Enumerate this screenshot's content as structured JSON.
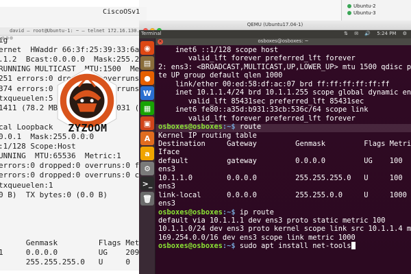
{
  "vm_list": {
    "items": [
      "Ubuntu-2",
      "Ubuntu-3"
    ]
  },
  "left_terminal": {
    "top_title": "CiscoOSv1",
    "titlebar": "david — root@Ubuntu-1: ~ — telnet 172.16.130.135 5005",
    "lines": [
      "ig",
      "ernet  HWaddr 66:3f:25:39:33:6a",
      ".1.2  Bcast:0.0.0.0  Mask:255.255.255.0",
      "RUNNING MULTICAST  MTU:1500  Metric:1",
      "251 errors:0 dropped:0 overruns:0",
      "374 errors:0 dropped:0 overruns:0",
      "txqueuelen:5",
      "1411 (78.2 MB)  TX bytes:2031 (20",
      "",
      "cal Loopback",
      "0.0.1  Mask:255.0.0.0",
      ":1/128 Scope:Host",
      "UNNING  MTU:65536  Metric:1",
      "errors:0 dropped:0 overruns:0 fram",
      "errors:0 dropped:0 overruns:0 carr",
      "txqueuelen:1",
      "0 B)  TX bytes:0 (0.0 B)",
      "",
      "",
      "",
      "",
      "      Genmask         Flags Met",
      "1     0.0.0.0         UG    209",
      "      255.255.255.0   U     0"
    ]
  },
  "logo": {
    "text": "ZYZOOM",
    "ring_color": "#d9541c",
    "icon": "samurai-helmet-icon"
  },
  "qemu": {
    "title": "QEMU (Ubuntu17.04-1)"
  },
  "ubuntu_panel": {
    "app_name": "Terminal",
    "tray": [
      "⇅",
      "✉",
      "🔊",
      "5:24 PM",
      "⚙"
    ]
  },
  "launcher": {
    "items": [
      {
        "icon": "ubuntu-dash-icon",
        "glyph": "◉",
        "color": "#dd4814"
      },
      {
        "icon": "files-icon",
        "glyph": "▤",
        "color": "#8a6d3b"
      },
      {
        "icon": "firefox-icon",
        "glyph": "●",
        "color": "#e66000"
      },
      {
        "icon": "writer-icon",
        "glyph": "W",
        "color": "#2a6fd0"
      },
      {
        "icon": "calc-icon",
        "glyph": "▦",
        "color": "#18a303"
      },
      {
        "icon": "impress-icon",
        "glyph": "▣",
        "color": "#d0451b"
      },
      {
        "icon": "software-icon",
        "glyph": "A",
        "color": "#e06c1f"
      },
      {
        "icon": "amazon-icon",
        "glyph": "a",
        "color": "#f0a400"
      },
      {
        "icon": "settings-icon",
        "glyph": "⚙",
        "color": "#7a7a7a"
      },
      {
        "icon": "terminal-icon",
        "glyph": ">_",
        "color": "#2b2b2b"
      },
      {
        "icon": "trash-icon",
        "glyph": "🗑",
        "color": "#6b6b6b"
      }
    ]
  },
  "terminal": {
    "title": "osboxes@osboxes: ~",
    "lines": [
      {
        "t": "    inet6 ::1/128 scope host"
      },
      {
        "t": "       valid_lft forever preferred_lft forever"
      },
      {
        "t": "2: ens3: <BROADCAST,MULTICAST,UP,LOWER_UP> mtu 1500 qdisc pfifo_fast sta"
      },
      {
        "t": "te UP group default qlen 1000"
      },
      {
        "t": "    link/ether 00:ed:58:df:ac:07 brd ff:ff:ff:ff:ff:ff"
      },
      {
        "t": "    inet 10.1.1.4/24 brd 10.1.1.255 scope global dynamic ens3"
      },
      {
        "t": "       valid_lft 85431sec preferred_lft 85431sec"
      },
      {
        "t": "    inet6 fe80::a35d:b931:33cb:536c/64 scope link"
      },
      {
        "t": "       valid_lft forever preferred_lft forever"
      },
      {
        "prompt_user": "osboxes@osboxes",
        "prompt_path": ":~$",
        "cmd": " route"
      },
      {
        "t": "Kernel IP routing table"
      },
      {
        "t": "Destination     Gateway         Genmask         Flags Metric Ref    Use"
      },
      {
        "t": "Iface"
      },
      {
        "t": "default         gateway         0.0.0.0         UG    100    0        0"
      },
      {
        "t": "ens3"
      },
      {
        "t": "10.1.1.0        0.0.0.0         255.255.255.0   U     100    0        0"
      },
      {
        "t": "ens3"
      },
      {
        "t": "link-local      0.0.0.0         255.255.0.0     U     1000   0        0"
      },
      {
        "t": "ens3"
      },
      {
        "prompt_user": "osboxes@osboxes",
        "prompt_path": ":~$",
        "cmd": " ip route"
      },
      {
        "t": "default via 10.1.1.1 dev ens3 proto static metric 100"
      },
      {
        "t": "10.1.1.0/24 dev ens3 proto kernel scope link src 10.1.1.4 metric 100"
      },
      {
        "t": "169.254.0.0/16 dev ens3 scope link metric 1000"
      },
      {
        "prompt_user": "osboxes@osboxes",
        "prompt_path": ":~$",
        "cmd": " sudo apt install net-tools",
        "cursor": true
      }
    ]
  }
}
